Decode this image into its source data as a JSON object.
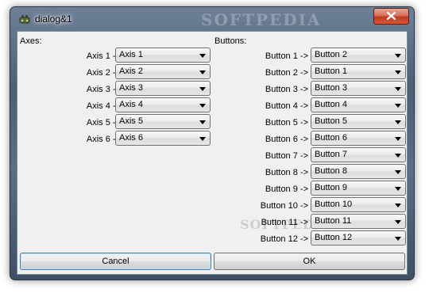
{
  "window": {
    "title": "dialog&1",
    "watermark": "SOFTPEDIA"
  },
  "axes": {
    "label": "Axes:",
    "rows": [
      {
        "label": "Axis 1 ->",
        "value": "Axis 1"
      },
      {
        "label": "Axis 2 ->",
        "value": "Axis 2"
      },
      {
        "label": "Axis 3 ->",
        "value": "Axis 3"
      },
      {
        "label": "Axis 4 ->",
        "value": "Axis 4"
      },
      {
        "label": "Axis 5 ->",
        "value": "Axis 5"
      },
      {
        "label": "Axis 6 ->",
        "value": "Axis 6"
      }
    ]
  },
  "buttons": {
    "label": "Buttons:",
    "rows": [
      {
        "label": "Button 1 ->",
        "value": "Button 2"
      },
      {
        "label": "Button 2 ->",
        "value": "Button 1"
      },
      {
        "label": "Button 3 ->",
        "value": "Button 3"
      },
      {
        "label": "Button 4 ->",
        "value": "Button 4"
      },
      {
        "label": "Button 5 ->",
        "value": "Button 5"
      },
      {
        "label": "Button 6 ->",
        "value": "Button 6"
      },
      {
        "label": "Button 7 ->",
        "value": "Button 7"
      },
      {
        "label": "Button 8 ->",
        "value": "Button 8"
      },
      {
        "label": "Button 9 ->",
        "value": "Button 9"
      },
      {
        "label": "Button 10 ->",
        "value": "Button 10"
      },
      {
        "label": "Button 11 ->",
        "value": "Button 11"
      },
      {
        "label": "Button 12 ->",
        "value": "Button 12"
      }
    ]
  },
  "footer": {
    "cancel_label": "Cancel",
    "ok_label": "OK"
  },
  "colors": {
    "accent": "#3c7fb1",
    "close_button": "#c23a1f"
  },
  "icons": {
    "app": "joystick-icon",
    "close": "close-icon",
    "dropdown": "chevron-down-icon"
  }
}
